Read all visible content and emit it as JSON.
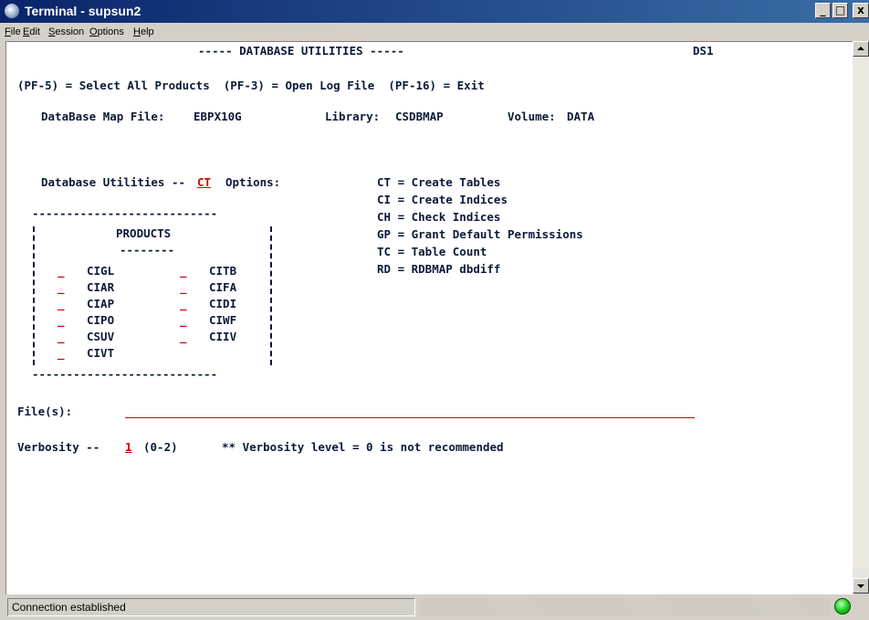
{
  "window": {
    "title": "Terminal - supsun2",
    "controls": {
      "minimize": "_",
      "maximize": "□",
      "close": "x"
    }
  },
  "menu": [
    {
      "pre": "",
      "u": "F",
      "post": "ile"
    },
    {
      "pre": "",
      "u": "E",
      "post": "dit"
    },
    {
      "pre": "",
      "u": "S",
      "post": "ession"
    },
    {
      "pre": "",
      "u": "O",
      "post": "ptions"
    },
    {
      "pre": "",
      "u": "H",
      "post": "elp"
    }
  ],
  "screen": {
    "header": "----- DATABASE UTILITIES -----",
    "screen_id": "DS1",
    "pf_keys": "(PF-5) = Select All Products  (PF-3) = Open Log File  (PF-16) = Exit",
    "map_file_label": "DataBase Map File:",
    "map_file_value": "EBPX10G",
    "library_label": "Library:",
    "library_value": "CSDBMAP",
    "volume_label": "Volume:",
    "volume_value": "DATA",
    "utilities_label": "Database Utilities --",
    "utilities_value": "CT",
    "options_label": "Options:",
    "options": [
      "CT = Create Tables",
      "CI = Create Indices",
      "CH = Check Indices",
      "GP = Grant Default Permissions",
      "TC = Table Count",
      "RD = RDBMAP dbdiff"
    ],
    "products_border": "---------------------------",
    "products_title": "PRODUCTS",
    "products_underline": "--------",
    "products_left": [
      "CIGL",
      "CIAR",
      "CIAP",
      "CIPO",
      "CSUV",
      "CIVT"
    ],
    "products_right": [
      "CITB",
      "CIFA",
      "CIDI",
      "CIWF",
      "CIIV"
    ],
    "product_field": "_",
    "files_label": "File(s):",
    "files_value": "",
    "verbosity_label": "Verbosity --",
    "verbosity_value": "1",
    "verbosity_range": "(0-2)",
    "verbosity_note": "** Verbosity level = 0 is not recommended"
  },
  "statusbar": {
    "text": "Connection established",
    "indicator_color": "#18c818"
  }
}
